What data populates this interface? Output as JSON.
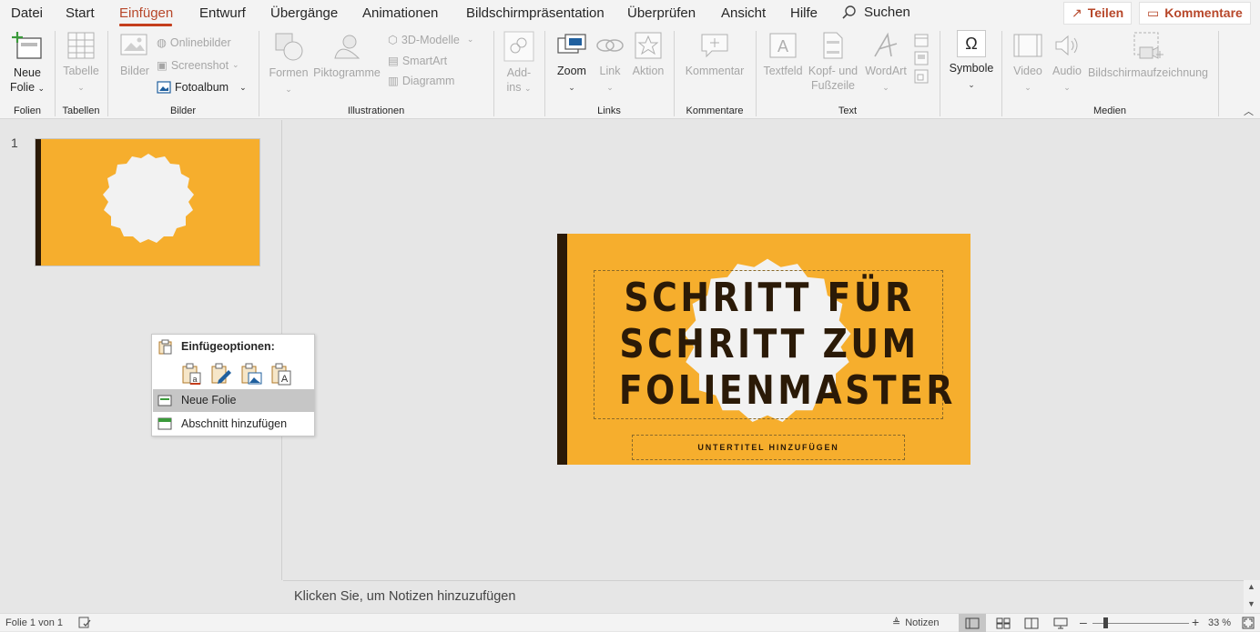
{
  "menu": {
    "tabs": [
      "Datei",
      "Start",
      "Einfügen",
      "Entwurf",
      "Übergänge",
      "Animationen",
      "Bildschirmpräsentation",
      "Überprüfen",
      "Ansicht",
      "Hilfe"
    ],
    "active_tab": "Einfügen",
    "search_label": "Suchen",
    "share_label": "Teilen",
    "comments_label": "Kommentare"
  },
  "ribbon": {
    "new_slide_line1": "Neue",
    "new_slide_line2": "Folie",
    "table": "Tabelle",
    "images": "Bilder",
    "online_images": "Onlinebilder",
    "screenshot": "Screenshot",
    "photo_album": "Fotoalbum",
    "shapes": "Formen",
    "icons": "Piktogramme",
    "models_3d": "3D-Modelle",
    "smartart": "SmartArt",
    "chart": "Diagramm",
    "addins_line1": "Add-",
    "addins_line2": "ins",
    "zoom": "Zoom",
    "link": "Link",
    "action": "Aktion",
    "comment": "Kommentar",
    "textbox": "Textfeld",
    "header_footer_line1": "Kopf- und",
    "header_footer_line2": "Fußzeile",
    "wordart": "WordArt",
    "symbols": "Symbole",
    "video": "Video",
    "audio": "Audio",
    "screen_recording": "Bildschirmaufzeichnung",
    "groups": {
      "slides": "Folien",
      "tables": "Tabellen",
      "images": "Bilder",
      "illustrations": "Illustrationen",
      "links": "Links",
      "comments": "Kommentare",
      "text": "Text",
      "media": "Medien"
    }
  },
  "thumbnails": [
    {
      "number": "1"
    }
  ],
  "context_menu": {
    "header": "Einfügeoptionen:",
    "items": [
      "Neue Folie",
      "Abschnitt hinzufügen"
    ]
  },
  "slide": {
    "title_lines": [
      "SCHRITT FÜR",
      "SCHRITT ZUM",
      "FOLIENMASTER"
    ],
    "subtitle": "UNTERTITEL HINZUFÜGEN"
  },
  "notes": {
    "placeholder": "Klicken Sie, um Notizen hinzuzufügen"
  },
  "status": {
    "slide_info": "Folie 1 von 1",
    "notes_label": "Notizen",
    "zoom": "33 %"
  },
  "colors": {
    "accent": "#c43e1c",
    "slide_background": "#f6ae2d",
    "slide_dark": "#2b1a07",
    "badge_light": "#f2f2f2"
  }
}
